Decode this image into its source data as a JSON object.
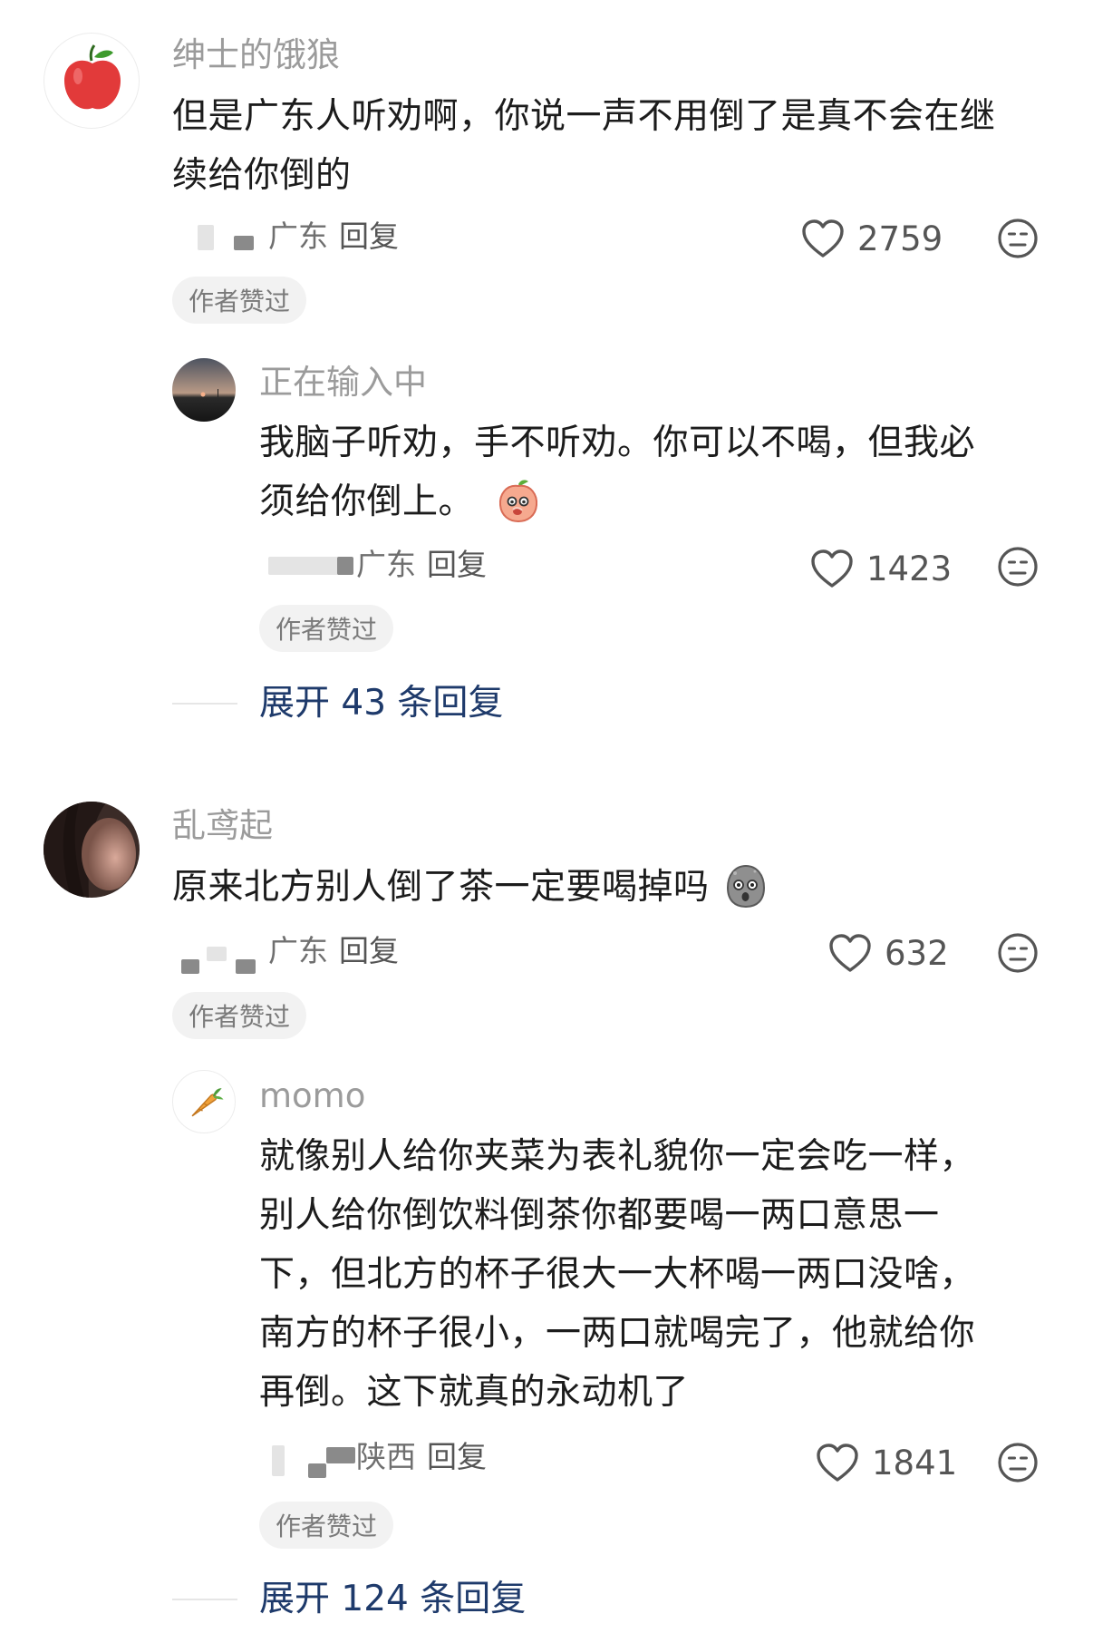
{
  "comments": [
    {
      "username": "绅士的饿狼",
      "lines": [
        "但是广东人听劝啊，你说一声不用倒了是真不会在继",
        "续给你倒的"
      ],
      "location": "广东",
      "reply_label": "回复",
      "likes": "2759",
      "author_liked": "作者赞过",
      "avatar_icon": "apple",
      "replies": [
        {
          "username": "正在输入中",
          "lines": [
            "我脑子听劝，手不听劝。你可以不喝，但我必",
            "须给你倒上。"
          ],
          "emoji": "peach-face-emoji",
          "location": "广东",
          "reply_label": "回复",
          "likes": "1423",
          "author_liked": "作者赞过",
          "avatar_icon": "sunset-photo"
        }
      ],
      "expand_label": "展开 43 条回复"
    },
    {
      "username": "乱鸢起",
      "lines": [
        "原来北方别人倒了茶一定要喝掉吗"
      ],
      "emoji": "shocked-stone-emoji",
      "location": "广东",
      "reply_label": "回复",
      "likes": "632",
      "author_liked": "作者赞过",
      "avatar_icon": "portrait-photo",
      "replies": [
        {
          "username": "momo",
          "lines": [
            "就像别人给你夹菜为表礼貌你一定会吃一样，",
            "别人给你倒饮料倒茶你都要喝一两口意思一",
            "下，但北方的杯子很大一大杯喝一两口没啥，",
            "南方的杯子很小，一两口就喝完了，他就给你",
            "再倒。这下就真的永动机了"
          ],
          "location": "陕西",
          "reply_label": "回复",
          "likes": "1841",
          "author_liked": "作者赞过",
          "avatar_icon": "carrot"
        }
      ],
      "expand_label": "展开 124 条回复"
    }
  ],
  "colors": {
    "username": "#9b9b9b",
    "text": "#1c1c1c",
    "link": "#1e3a6b",
    "badge_bg": "#f2f2f2"
  }
}
